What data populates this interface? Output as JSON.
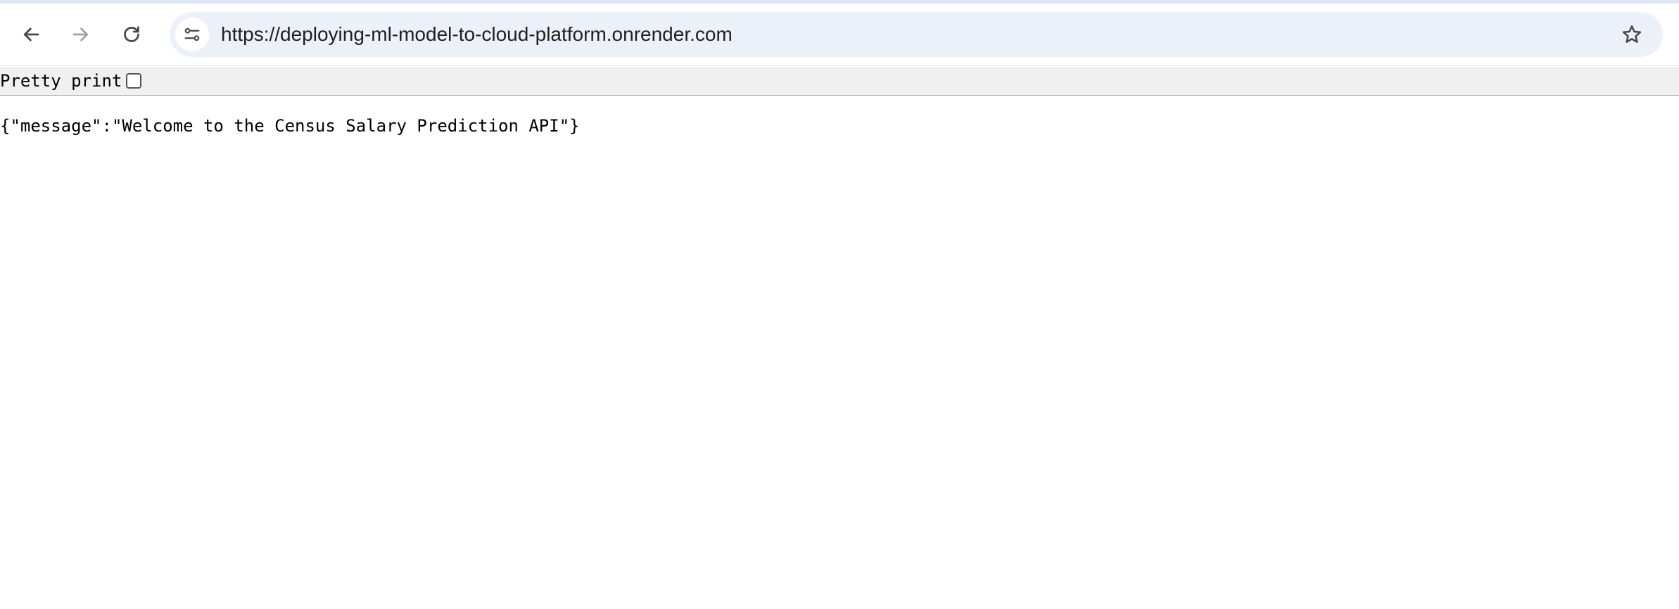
{
  "browser": {
    "url": "https://deploying-ml-model-to-cloud-platform.onrender.com",
    "icons": {
      "back": "back-arrow-icon",
      "forward": "forward-arrow-icon",
      "reload": "reload-icon",
      "site_info": "tune-icon",
      "bookmark": "star-icon"
    },
    "forward_enabled": false
  },
  "viewer": {
    "pretty_print_label": "Pretty print",
    "pretty_print_checked": false
  },
  "content": {
    "raw_json": "{\"message\":\"Welcome to the Census Salary Prediction API\"}"
  },
  "colors": {
    "omnibox_bg": "#ebf0f9",
    "toolbar_bg": "#ffffff",
    "pretty_bar_bg": "#f0f0f0",
    "icon_active": "#474747",
    "icon_disabled": "#a0a0a0"
  }
}
